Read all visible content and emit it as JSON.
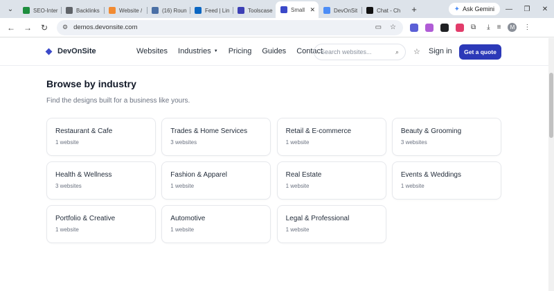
{
  "browser": {
    "tabs": [
      {
        "title": "SEO-Inter",
        "favicon_color": "#1e8e3e",
        "active": false
      },
      {
        "title": "Backlinks",
        "favicon_color": "#5f6368",
        "active": false
      },
      {
        "title": "Website /",
        "favicon_color": "#f28b32",
        "active": false
      },
      {
        "title": "(16) Roun",
        "favicon_color": "#4a6fa5",
        "active": false
      },
      {
        "title": "Feed | Lin",
        "favicon_color": "#0a66c2",
        "active": false
      },
      {
        "title": "Toolscase",
        "favicon_color": "#3c3fb5",
        "active": false
      },
      {
        "title": "Small",
        "favicon_color": "#3b49c9",
        "active": true
      },
      {
        "title": "DevOnSit",
        "favicon_color": "#4c8df6",
        "active": false
      },
      {
        "title": "Chat - Ch",
        "favicon_color": "#111111",
        "active": false
      }
    ],
    "gemini_label": "Ask Gemini",
    "url": "demos.devonsite.com",
    "profile_initial": "M",
    "extension_colors": [
      "#5b5fd6",
      "#b05cd6",
      "#202124",
      "#e23c6a"
    ]
  },
  "site": {
    "brand": "DevOnSite",
    "nav": [
      "Websites",
      "Industries",
      "Pricing",
      "Guides",
      "Contact"
    ],
    "search_placeholder": "Search websites...",
    "signin": "Sign in",
    "cta": "Get a quote",
    "accent_color": "#2c39b8"
  },
  "section": {
    "title": "Browse by industry",
    "subtitle": "Find the designs built for a business like yours."
  },
  "industries": [
    {
      "name": "Restaurant & Cafe",
      "count": "1 website"
    },
    {
      "name": "Trades & Home Services",
      "count": "3 websites"
    },
    {
      "name": "Retail & E-commerce",
      "count": "1 website"
    },
    {
      "name": "Beauty & Grooming",
      "count": "3 websites"
    },
    {
      "name": "Health & Wellness",
      "count": "3 websites"
    },
    {
      "name": "Fashion & Apparel",
      "count": "1 website"
    },
    {
      "name": "Real Estate",
      "count": "1 website"
    },
    {
      "name": "Events & Weddings",
      "count": "1 website"
    },
    {
      "name": "Portfolio & Creative",
      "count": "1 website"
    },
    {
      "name": "Automotive",
      "count": "1 website"
    },
    {
      "name": "Legal & Professional",
      "count": "1 website"
    }
  ]
}
